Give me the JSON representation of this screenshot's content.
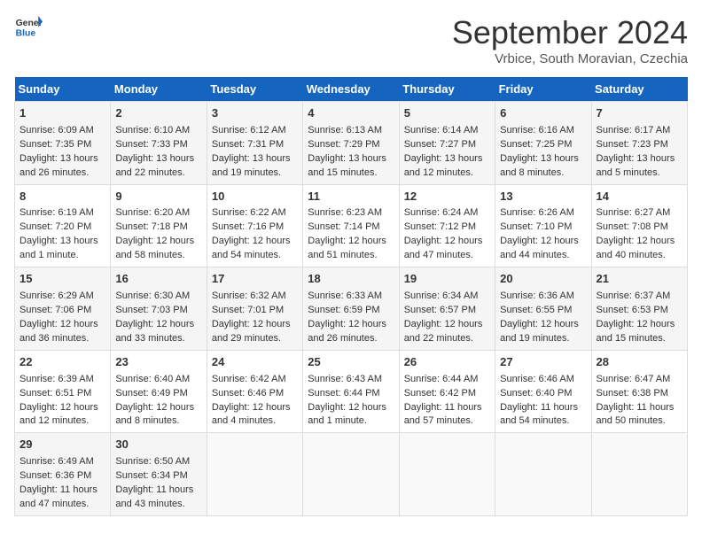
{
  "logo": {
    "line1": "General",
    "line2": "Blue"
  },
  "title": "September 2024",
  "subtitle": "Vrbice, South Moravian, Czechia",
  "days_of_week": [
    "Sunday",
    "Monday",
    "Tuesday",
    "Wednesday",
    "Thursday",
    "Friday",
    "Saturday"
  ],
  "weeks": [
    [
      {
        "day": 1,
        "sunrise": "6:09 AM",
        "sunset": "7:35 PM",
        "daylight": "13 hours and 26 minutes."
      },
      {
        "day": 2,
        "sunrise": "6:10 AM",
        "sunset": "7:33 PM",
        "daylight": "13 hours and 22 minutes."
      },
      {
        "day": 3,
        "sunrise": "6:12 AM",
        "sunset": "7:31 PM",
        "daylight": "13 hours and 19 minutes."
      },
      {
        "day": 4,
        "sunrise": "6:13 AM",
        "sunset": "7:29 PM",
        "daylight": "13 hours and 15 minutes."
      },
      {
        "day": 5,
        "sunrise": "6:14 AM",
        "sunset": "7:27 PM",
        "daylight": "13 hours and 12 minutes."
      },
      {
        "day": 6,
        "sunrise": "6:16 AM",
        "sunset": "7:25 PM",
        "daylight": "13 hours and 8 minutes."
      },
      {
        "day": 7,
        "sunrise": "6:17 AM",
        "sunset": "7:23 PM",
        "daylight": "13 hours and 5 minutes."
      }
    ],
    [
      {
        "day": 8,
        "sunrise": "6:19 AM",
        "sunset": "7:20 PM",
        "daylight": "13 hours and 1 minute."
      },
      {
        "day": 9,
        "sunrise": "6:20 AM",
        "sunset": "7:18 PM",
        "daylight": "12 hours and 58 minutes."
      },
      {
        "day": 10,
        "sunrise": "6:22 AM",
        "sunset": "7:16 PM",
        "daylight": "12 hours and 54 minutes."
      },
      {
        "day": 11,
        "sunrise": "6:23 AM",
        "sunset": "7:14 PM",
        "daylight": "12 hours and 51 minutes."
      },
      {
        "day": 12,
        "sunrise": "6:24 AM",
        "sunset": "7:12 PM",
        "daylight": "12 hours and 47 minutes."
      },
      {
        "day": 13,
        "sunrise": "6:26 AM",
        "sunset": "7:10 PM",
        "daylight": "12 hours and 44 minutes."
      },
      {
        "day": 14,
        "sunrise": "6:27 AM",
        "sunset": "7:08 PM",
        "daylight": "12 hours and 40 minutes."
      }
    ],
    [
      {
        "day": 15,
        "sunrise": "6:29 AM",
        "sunset": "7:06 PM",
        "daylight": "12 hours and 36 minutes."
      },
      {
        "day": 16,
        "sunrise": "6:30 AM",
        "sunset": "7:03 PM",
        "daylight": "12 hours and 33 minutes."
      },
      {
        "day": 17,
        "sunrise": "6:32 AM",
        "sunset": "7:01 PM",
        "daylight": "12 hours and 29 minutes."
      },
      {
        "day": 18,
        "sunrise": "6:33 AM",
        "sunset": "6:59 PM",
        "daylight": "12 hours and 26 minutes."
      },
      {
        "day": 19,
        "sunrise": "6:34 AM",
        "sunset": "6:57 PM",
        "daylight": "12 hours and 22 minutes."
      },
      {
        "day": 20,
        "sunrise": "6:36 AM",
        "sunset": "6:55 PM",
        "daylight": "12 hours and 19 minutes."
      },
      {
        "day": 21,
        "sunrise": "6:37 AM",
        "sunset": "6:53 PM",
        "daylight": "12 hours and 15 minutes."
      }
    ],
    [
      {
        "day": 22,
        "sunrise": "6:39 AM",
        "sunset": "6:51 PM",
        "daylight": "12 hours and 12 minutes."
      },
      {
        "day": 23,
        "sunrise": "6:40 AM",
        "sunset": "6:49 PM",
        "daylight": "12 hours and 8 minutes."
      },
      {
        "day": 24,
        "sunrise": "6:42 AM",
        "sunset": "6:46 PM",
        "daylight": "12 hours and 4 minutes."
      },
      {
        "day": 25,
        "sunrise": "6:43 AM",
        "sunset": "6:44 PM",
        "daylight": "12 hours and 1 minute."
      },
      {
        "day": 26,
        "sunrise": "6:44 AM",
        "sunset": "6:42 PM",
        "daylight": "11 hours and 57 minutes."
      },
      {
        "day": 27,
        "sunrise": "6:46 AM",
        "sunset": "6:40 PM",
        "daylight": "11 hours and 54 minutes."
      },
      {
        "day": 28,
        "sunrise": "6:47 AM",
        "sunset": "6:38 PM",
        "daylight": "11 hours and 50 minutes."
      }
    ],
    [
      {
        "day": 29,
        "sunrise": "6:49 AM",
        "sunset": "6:36 PM",
        "daylight": "11 hours and 47 minutes."
      },
      {
        "day": 30,
        "sunrise": "6:50 AM",
        "sunset": "6:34 PM",
        "daylight": "11 hours and 43 minutes."
      },
      null,
      null,
      null,
      null,
      null
    ]
  ]
}
